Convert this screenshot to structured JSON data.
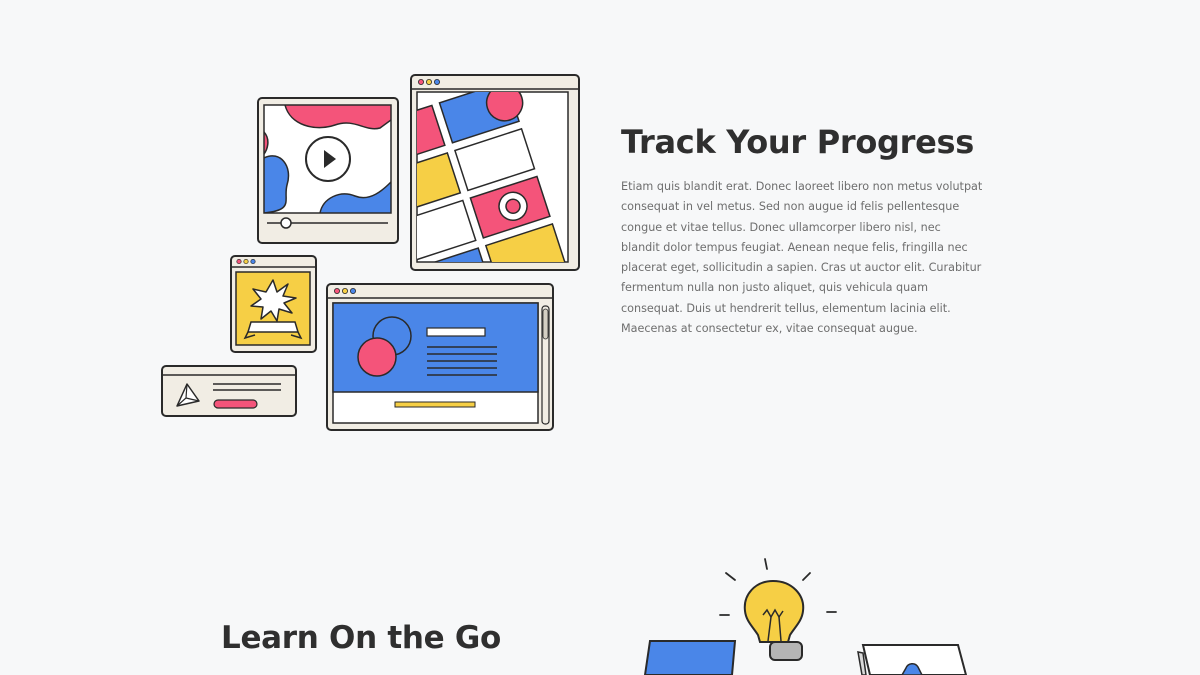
{
  "track_section": {
    "title": "Track Your Progress",
    "body": "Etiam quis blandit erat. Donec laoreet libero non metus volutpat consequat in vel metus. Sed non augue id felis pellentesque congue et vitae tellus. Donec ullamcorper libero nisl, nec blandit dolor tempus feugiat. Aenean neque felis, fringilla nec placerat eget, sollicitudin a sapien. Cras ut auctor elit. Curabitur fermentum nulla non justo aliquet, quis vehicula quam consequat. Duis ut hendrerit tellus, elementum lacinia elit. Maecenas at consectetur ex, vitae consequat augue.",
    "illustration": "learning-windows-illustration"
  },
  "learn_section": {
    "title": "Learn On the Go",
    "illustration": "lightbulb-devices-illustration"
  },
  "colors": {
    "background": "#f7f8f9",
    "heading": "#2f2f2f",
    "body_text": "#6e6e6e",
    "outline": "#2a2a2a",
    "window_frame": "#f1ede4",
    "blue": "#4a86e8",
    "pink": "#f4547a",
    "yellow": "#f6cf45"
  },
  "icons": [
    "play-icon",
    "starburst-badge-icon",
    "prism-icon",
    "lightbulb-icon",
    "window-dots-icon"
  ]
}
